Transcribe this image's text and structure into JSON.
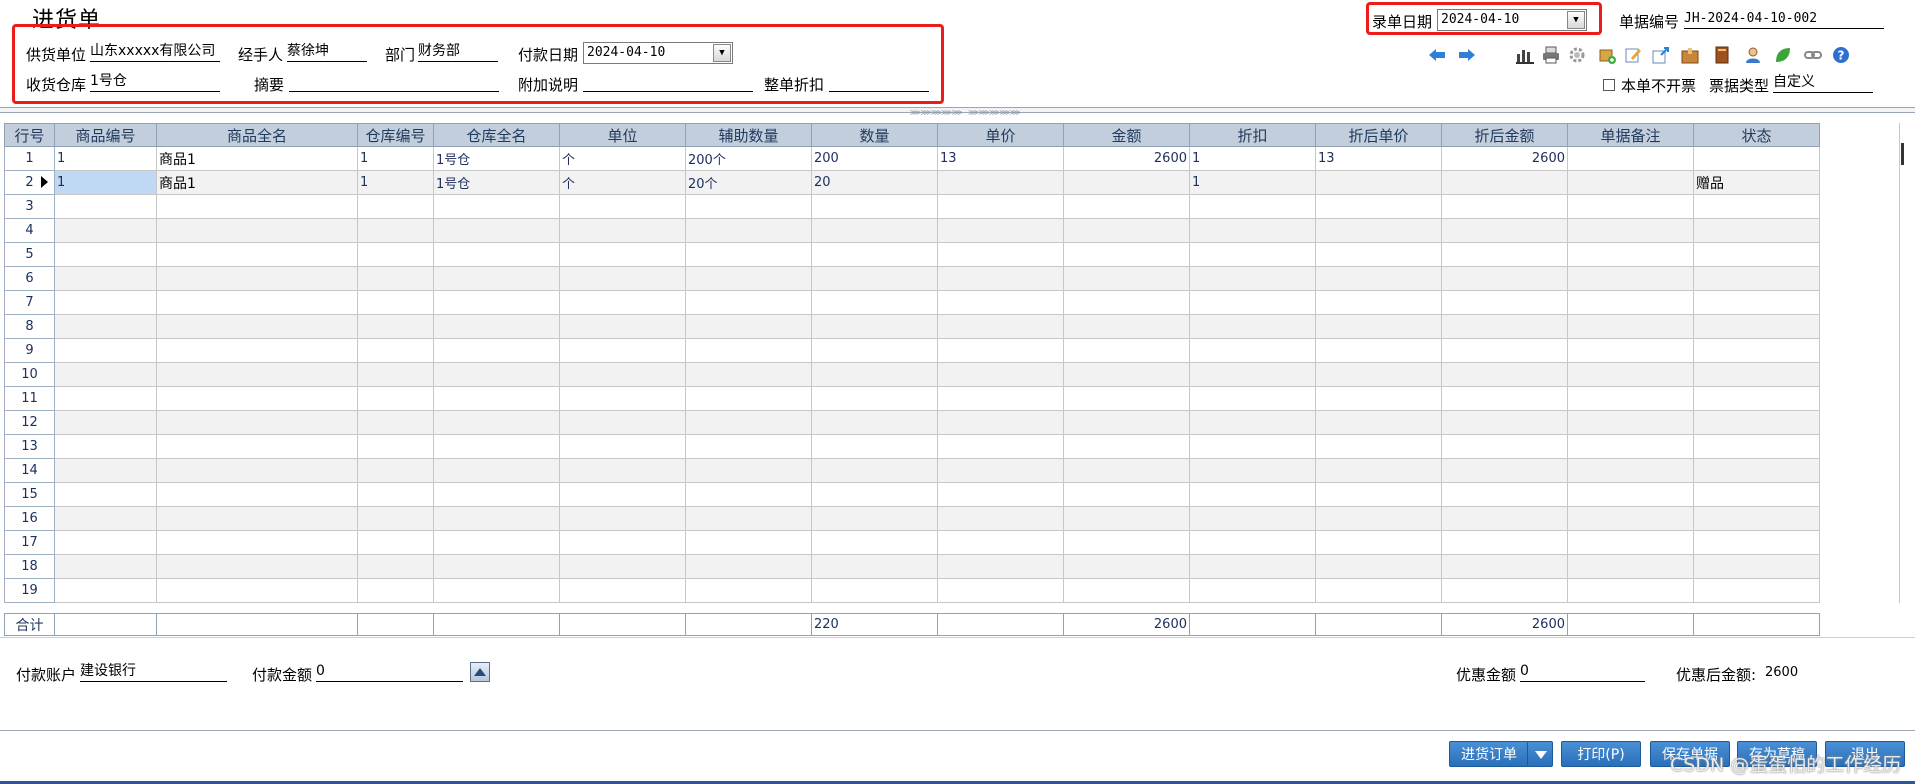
{
  "window": {
    "title": "进货单"
  },
  "header": {
    "supplier_label": "供货单位",
    "supplier_value": "山东xxxxx有限公司",
    "handler_label": "经手人",
    "handler_value": "蔡徐坤",
    "dept_label": "部门",
    "dept_value": "财务部",
    "paydate_label": "付款日期",
    "paydate_value": "2024-04-10",
    "warehouse_label": "收货仓库",
    "warehouse_value": "1号仓",
    "summary_label": "摘要",
    "summary_value": "",
    "extra_label": "附加说明",
    "extra_value": "",
    "discount_label": "整单折扣",
    "discount_value": "",
    "entrydate_label": "录单日期",
    "entrydate_value": "2024-04-10",
    "docno_label": "单据编号",
    "docno_value": "JH-2024-04-10-002",
    "noinvoice_label": "本单不开票",
    "doctype_label": "票据类型",
    "doctype_value": "自定义"
  },
  "toolbar_icons": [
    "arrow-left-icon",
    "arrow-right-icon",
    "chart-icon",
    "printer-icon",
    "gear-icon",
    "box-add-icon",
    "edit-icon",
    "export-icon",
    "package-icon",
    "book-icon",
    "user-icon",
    "leaf-icon",
    "link-icon",
    "help-icon"
  ],
  "grid": {
    "columns": [
      "行号",
      "商品编号",
      "商品全名",
      "仓库编号",
      "仓库全名",
      "单位",
      "辅助数量",
      "数量",
      "单价",
      "金额",
      "折扣",
      "折后单价",
      "折后金额",
      "单据备注",
      "状态"
    ],
    "rows": [
      {
        "no": "1",
        "code": "1",
        "name": "商品1",
        "wh_code": "1",
        "wh_name": "1号仓",
        "unit": "个",
        "aux_qty": "200个",
        "qty": "200",
        "price": "13",
        "amount": "2600",
        "discount": "1",
        "disc_price": "13",
        "disc_amount": "2600",
        "note": "",
        "status": ""
      },
      {
        "no": "2",
        "code": "1",
        "name": "商品1",
        "wh_code": "1",
        "wh_name": "1号仓",
        "unit": "个",
        "aux_qty": "20个",
        "qty": "20",
        "price": "",
        "amount": "",
        "discount": "1",
        "disc_price": "",
        "disc_amount": "",
        "note": "",
        "status": "赠品"
      },
      {
        "no": "3"
      },
      {
        "no": "4"
      },
      {
        "no": "5"
      },
      {
        "no": "6"
      },
      {
        "no": "7"
      },
      {
        "no": "8"
      },
      {
        "no": "9"
      },
      {
        "no": "10"
      },
      {
        "no": "11"
      },
      {
        "no": "12"
      },
      {
        "no": "13"
      },
      {
        "no": "14"
      },
      {
        "no": "15"
      },
      {
        "no": "16"
      },
      {
        "no": "17"
      },
      {
        "no": "18"
      },
      {
        "no": "19"
      }
    ],
    "total": {
      "label": "合计",
      "qty": "220",
      "amount": "2600",
      "disc_amount": "2600"
    }
  },
  "footer": {
    "account_label": "付款账户",
    "account_value": "建设银行",
    "payamount_label": "付款金额",
    "payamount_value": "0",
    "discount_amount_label": "优惠金额",
    "discount_amount_value": "0",
    "after_discount_label": "优惠后金额:",
    "after_discount_value": "2600"
  },
  "buttons": {
    "purchase_order": "进货订单",
    "print": "打印(P)",
    "save": "保存单据",
    "draft": "存为草稿",
    "exit": "退出"
  },
  "watermark": "CSDN @蛋蛋怕的工作经历",
  "colors": {
    "red_highlight": "#ee1b1b",
    "header_bg": "#c3cedc",
    "button_blue": "#2a6fb9",
    "selected_cell": "#bfd9f5"
  }
}
